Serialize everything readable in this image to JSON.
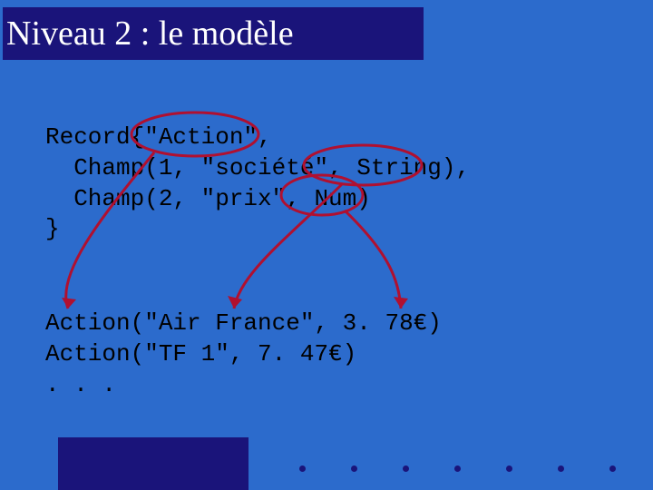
{
  "title": "Niveau 2 : le modèle",
  "code": {
    "l1": "Record{\"Action\",",
    "l2": "  Champ(1, \"société\", String),",
    "l3": "  Champ(2, \"prix\", Num)",
    "l4": "}"
  },
  "examples": {
    "l1": "Action(\"Air France\", 3. 78€)",
    "l2": "Action(\"TF 1\", 7. 47€)",
    "l3": ". . ."
  }
}
